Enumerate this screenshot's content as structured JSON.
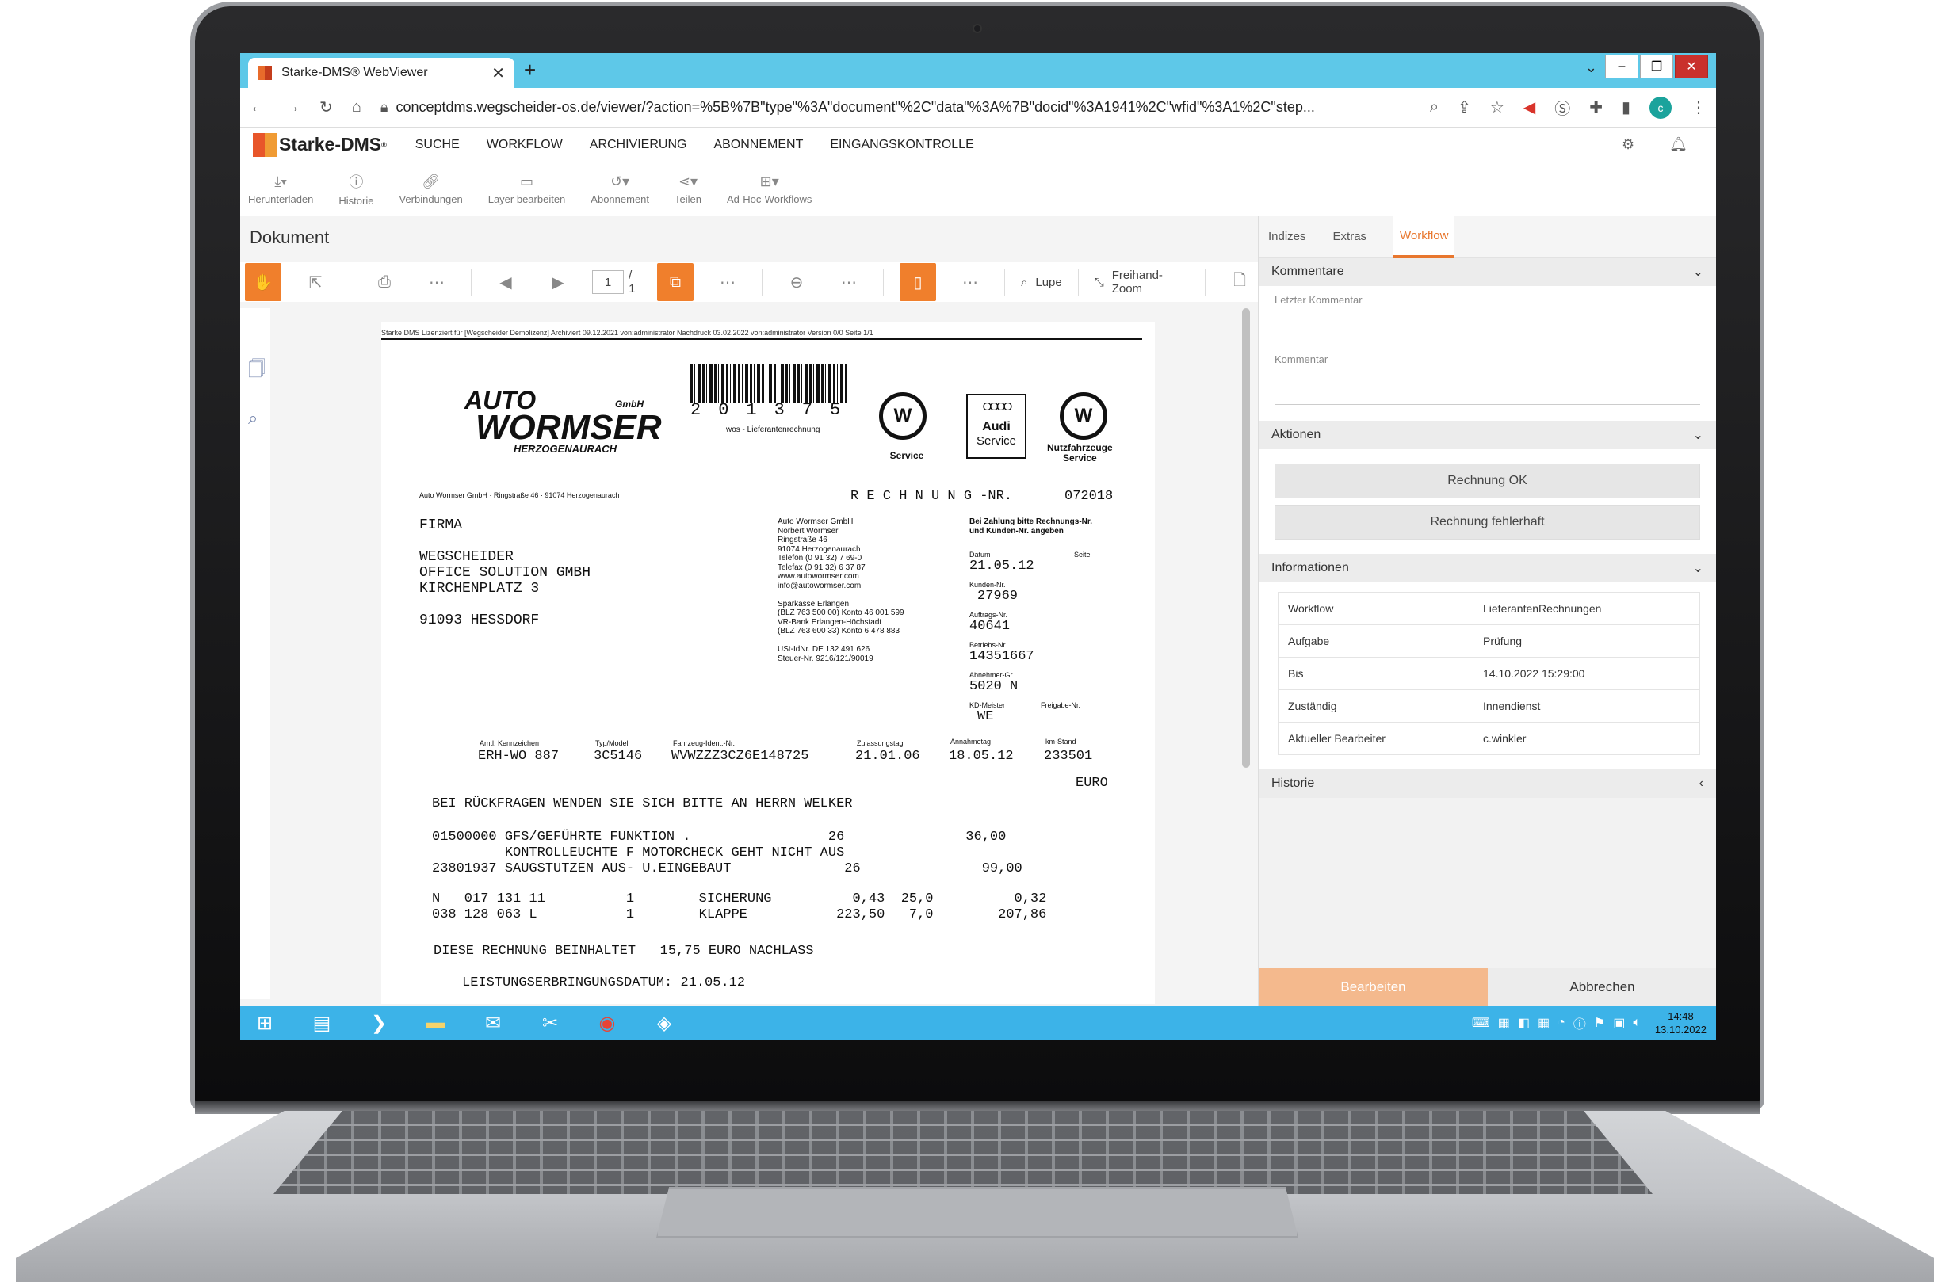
{
  "browser": {
    "tab_title": "Starke-DMS® WebViewer",
    "tab_close": "✕",
    "new_tab": "+",
    "url": "conceptdms.wegscheider-os.de/viewer/?action=%5B%7B\"type\"%3A\"document\"%2C\"data\"%3A%7B\"docid\"%3A1941%2C\"wfid\"%3A1%2C\"step...",
    "avatar_letter": "c"
  },
  "app": {
    "logo": "Starke-DMS",
    "menu": [
      "SUCHE",
      "WORKFLOW",
      "ARCHIVIERUNG",
      "ABONNEMENT",
      "EINGANGSKONTROLLE"
    ]
  },
  "toolbar": [
    "Herunterladen",
    "Historie",
    "Verbindungen",
    "Layer bearbeiten",
    "Abonnement",
    "Teilen",
    "Ad-Hoc-Workflows"
  ],
  "viewer": {
    "title": "Dokument",
    "page_current": "1",
    "page_total": "/ 1",
    "lupe": "Lupe",
    "freihand": "Freihand-Zoom"
  },
  "invoice": {
    "header_line": "Starke DMS Lizenziert für [Wegscheider Demolizenz] Archiviert 09.12.2021 von:administrator Nachdruck 03.02.2022 von:administrator Version 0/0 Seite 1/1",
    "logo_auto": "AUTO",
    "logo_wormser": "WORMSER",
    "logo_herz": "HERZOGENAURACH",
    "logo_gmbh": "GmbH",
    "barcode_number": "201375",
    "barcode_label": "wos - Lieferantenrechnung",
    "brand_vw_service": "Service",
    "audi_rings": "OOOO",
    "audi_1": "Audi",
    "audi_2": "Service",
    "brand_nutz": "Nutzfahrzeuge\nService",
    "sender_line": "Auto Wormser GmbH · Ringstraße 46 · 91074 Herzogenaurach",
    "rechnung_label": "R E C H N U N G -NR.",
    "rechnung_nr": "072018",
    "address": "FIRMA\n\nWEGSCHEIDER\nOFFICE SOLUTION GMBH\nKIRCHENPLATZ 3\n\n91093 HESSDORF",
    "company_block": "Auto Wormser GmbH\nNorbert Wormser\nRingstraße 46\n91074 Herzogenaurach\nTelefon (0 91 32) 7 69-0\nTelefax (0 91 32) 6 37 87\nwww.autowormser.com\ninfo@autowormser.com\n\nSparkasse Erlangen\n(BLZ 763 500 00) Konto 46 001 599\nVR-Bank Erlangen-Höchstadt\n(BLZ 763 600 33) Konto 6 478 883\n\nUSt-IdNr. DE 132 491 626\nSteuer-Nr. 9216/121/90019",
    "zahlung_note": "Bei Zahlung bitte Rechnungs-Nr.\nund Kunden-Nr. angeben",
    "datum_lbl": "Datum",
    "seite_lbl": "Seite",
    "datum": "21.05.12",
    "kunden_lbl": "Kunden-Nr.",
    "kunden": "27969",
    "auftrags_lbl": "Auftrags-Nr.",
    "auftrags": "40641",
    "betriebs_lbl": "Betriebs-Nr.",
    "betriebs": "14351667",
    "abnehmer_lbl": "Abnehmer-Gr.",
    "abnehmer": "5020 N",
    "kd_lbl": "KD-Meister",
    "freigabe_lbl": "Freigabe-Nr.",
    "kd": "WE",
    "vehicle_headers": [
      "Amtl. Kennzeichen",
      "Typ/Modell",
      "Fahrzeug-Ident.-Nr.",
      "Zulassungstag",
      "Annahmetag",
      "km-Stand"
    ],
    "vehicle_values": [
      "ERH-WO 887",
      "3C5146",
      "WVWZZZ3CZ6E148725",
      "21.01.06",
      "18.05.12",
      "233501"
    ],
    "euro": "EURO",
    "body_1": "BEI RÜCKFRAGEN WENDEN SIE SICH BITTE AN HERRN WELKER",
    "body_2": "01500000 GFS/GEFÜHRTE FUNKTION .                 26               36,00\n         KONTROLLEUCHTE F MOTORCHECK GEHT NICHT AUS\n23801937 SAUGSTUTZEN AUS- U.EINGEBAUT              26               99,00",
    "body_3": "N   017 131 11          1        SICHERUNG          0,43  25,0          0,32\n038 128 063 L           1        KLAPPE           223,50   7,0        207,86",
    "body_4": "DIESE RECHNUNG BEINHALTET   15,75 EURO NACHLASS",
    "body_5": "LEISTUNGSERBRINGUNGSDATUM: 21.05.12"
  },
  "right": {
    "tabs": [
      "Indizes",
      "Extras",
      "Workflow"
    ],
    "kommentare": "Kommentare",
    "letzter": "Letzter Kommentar",
    "kommentar": "Kommentar",
    "aktionen": "Aktionen",
    "btn_ok": "Rechnung OK",
    "btn_fehler": "Rechnung fehlerhaft",
    "informationen": "Informationen",
    "info_rows": [
      [
        "Workflow",
        "LieferantenRechnungen"
      ],
      [
        "Aufgabe",
        "Prüfung"
      ],
      [
        "Bis",
        "14.10.2022 15:29:00"
      ],
      [
        "Zuständig",
        "Innendienst"
      ],
      [
        "Aktueller Bearbeiter",
        "c.winkler"
      ]
    ],
    "historie": "Historie",
    "bearbeiten": "Bearbeiten",
    "abbrechen": "Abbrechen"
  },
  "taskbar": {
    "time": "14:48",
    "date": "13.10.2022"
  }
}
